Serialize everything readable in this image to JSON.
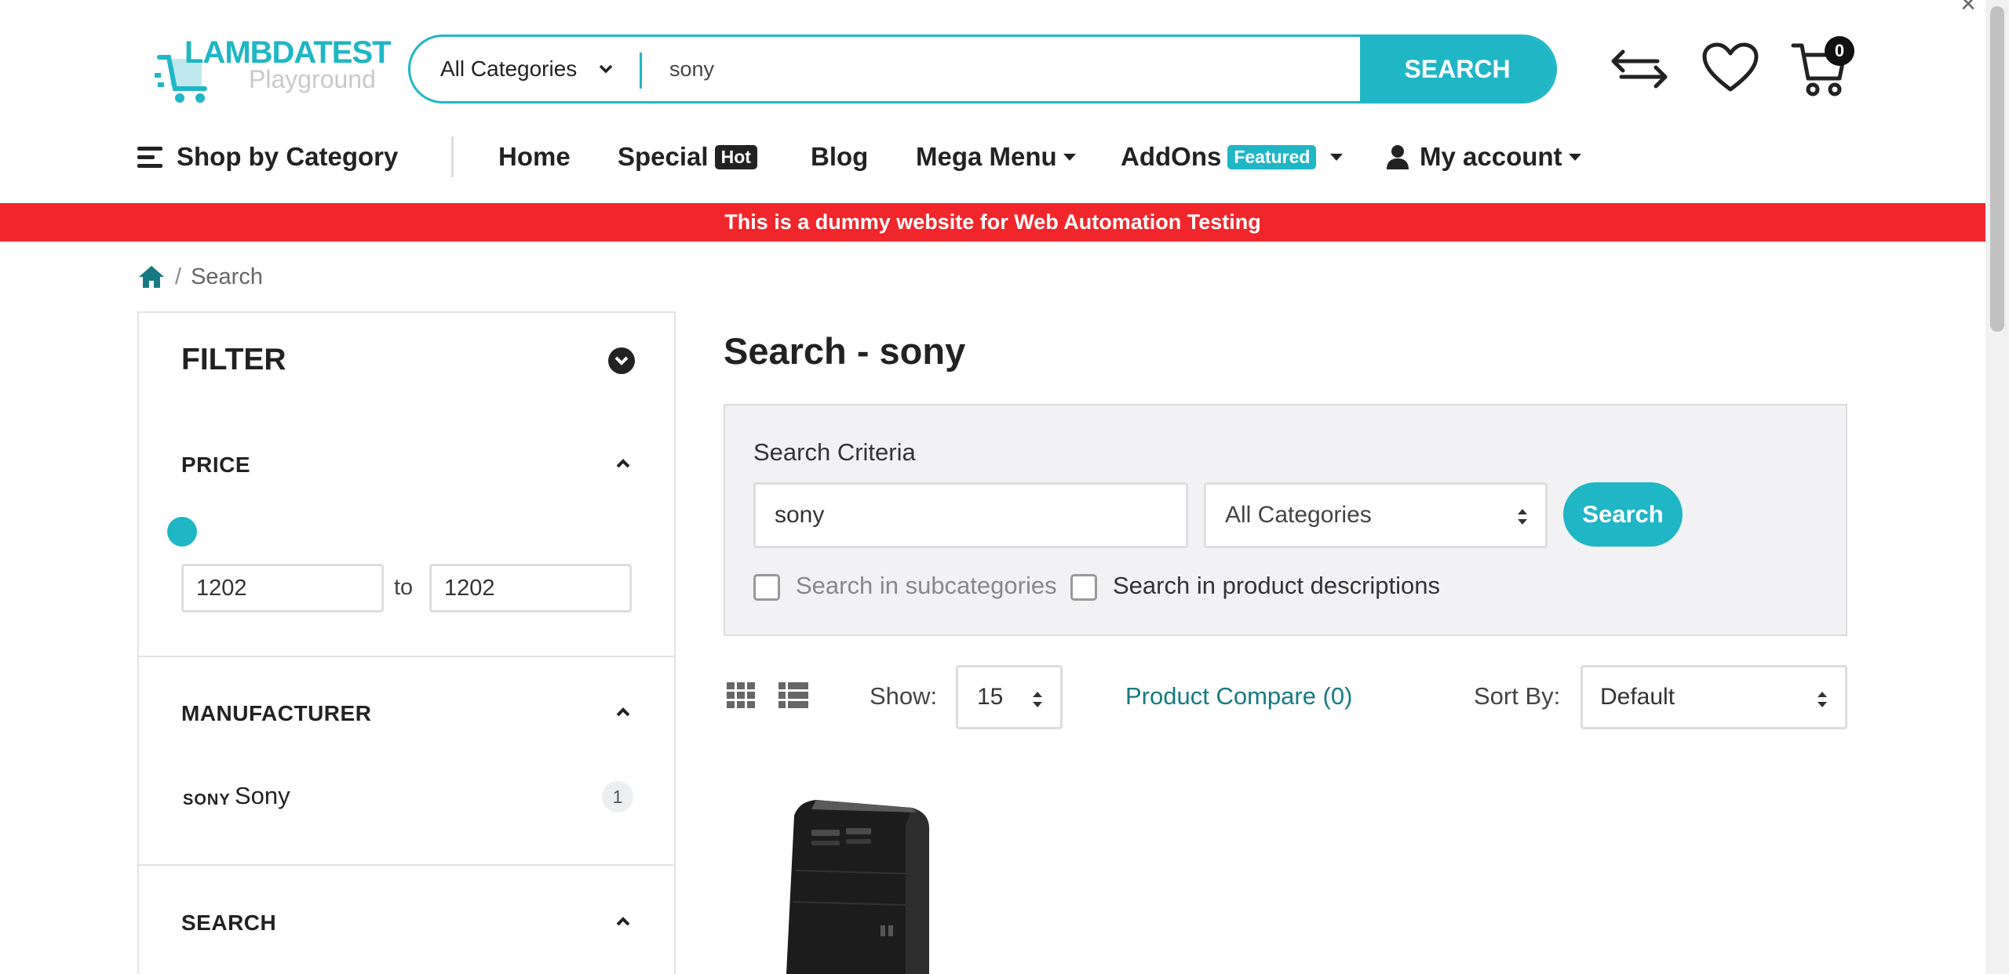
{
  "header": {
    "logo": {
      "line1": "LAMBDATEST",
      "line2": "Playground"
    },
    "search": {
      "category": "All Categories",
      "query": "sony",
      "button": "SEARCH"
    },
    "icons": [
      "compare-arrows-icon",
      "heart-icon",
      "cart-icon"
    ],
    "cart_count": "0"
  },
  "nav": {
    "shop_by_category": "Shop by Category",
    "home": "Home",
    "special": "Special",
    "special_tag": "Hot",
    "blog": "Blog",
    "mega_menu": "Mega Menu",
    "addons": "AddOns",
    "addons_tag": "Featured",
    "my_account": "My account"
  },
  "banner": "This is a dummy website for Web Automation Testing",
  "breadcrumb": {
    "current": "Search"
  },
  "sidebar": {
    "filter_title": "FILTER",
    "price": {
      "heading": "PRICE",
      "min": "1202",
      "to": "to",
      "max": "1202"
    },
    "manufacturer": {
      "heading": "MANUFACTURER",
      "logo_text": "SONY",
      "name": "Sony",
      "count": "1"
    },
    "search": {
      "heading": "SEARCH"
    }
  },
  "main": {
    "title": "Search - sony",
    "criteria": {
      "label": "Search Criteria",
      "query": "sony",
      "category": "All Categories",
      "button": "Search",
      "subcategories": "Search in subcategories",
      "descriptions": "Search in product descriptions"
    },
    "toolbar": {
      "show_label": "Show:",
      "show_value": "15",
      "compare": "Product Compare (0)",
      "sort_label": "Sort By:",
      "sort_value": "Default"
    }
  },
  "colors": {
    "accent": "#1fb6c6",
    "banner": "#f1262b",
    "link": "#167a83",
    "hot_tag": "#222222"
  }
}
